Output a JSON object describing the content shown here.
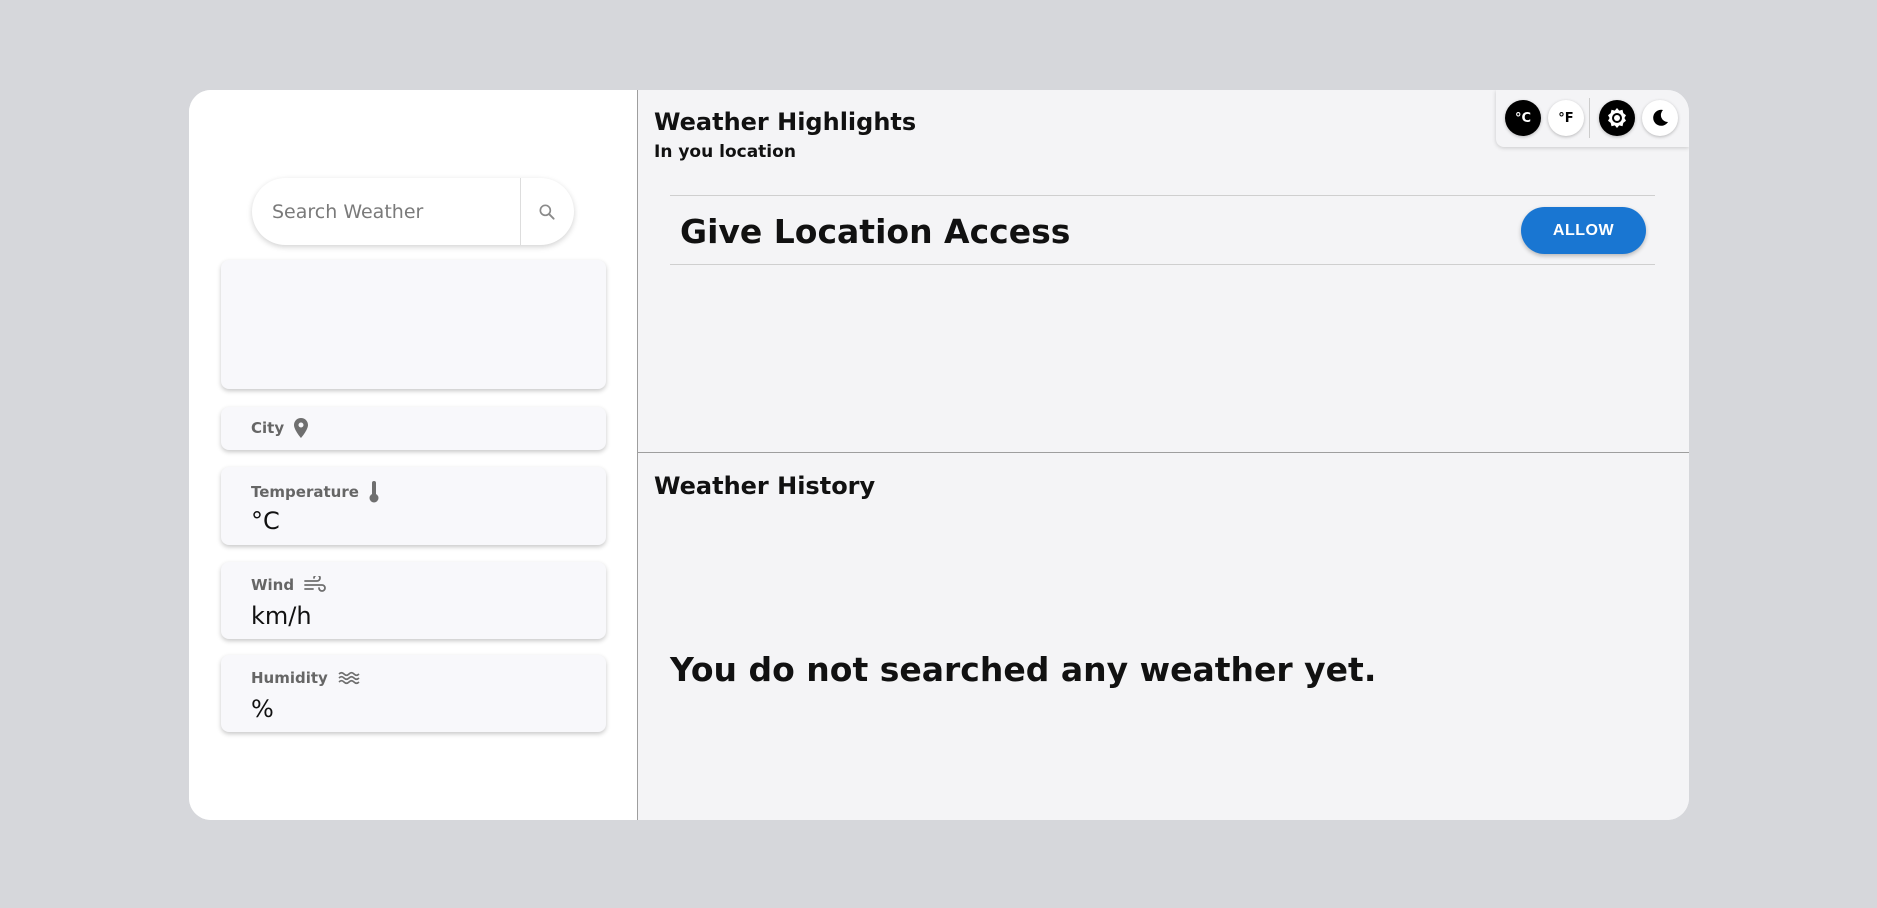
{
  "search": {
    "placeholder": "Search Weather",
    "icon": "search-icon"
  },
  "cards": {
    "city": {
      "label": "City",
      "icon": "location-pin-icon",
      "value": ""
    },
    "temperature": {
      "label": "Temperature",
      "icon": "thermometer-icon",
      "value": "°C"
    },
    "wind": {
      "label": "Wind",
      "icon": "wind-icon",
      "value": "km/h"
    },
    "humidity": {
      "label": "Humidity",
      "icon": "humidity-waves-icon",
      "value": "%"
    }
  },
  "highlights": {
    "title": "Weather Highlights",
    "subtitle": "In you location",
    "access_text": "Give Location Access",
    "allow_label": "ALLOW"
  },
  "toolbar": {
    "celsius_label": "°C",
    "fahrenheit_label": "°F",
    "settings_icon": "gear-icon",
    "theme_icon": "moon-icon"
  },
  "history": {
    "title": "Weather History",
    "empty_text": "You do not searched any weather yet."
  },
  "colors": {
    "accent": "#1976d2",
    "background": "#d6d7db",
    "panel": "#f4f4f6"
  }
}
